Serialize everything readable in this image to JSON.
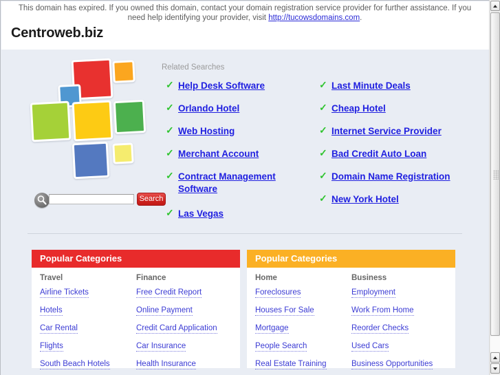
{
  "notice": {
    "text_before": "This domain has expired. If you owned this domain, contact your domain registration service provider for further assistance. If you need help identifying your provider, visit ",
    "link": "http://tucowsdomains.com",
    "text_after": "."
  },
  "site": {
    "title": "Centroweb.biz"
  },
  "logo": {
    "name": "colored-squares-mosaic",
    "colors": {
      "red": "#e8312f",
      "orange": "#fba61f",
      "blue_small": "#4f97d1",
      "green_light": "#a5d138",
      "yellow": "#fdcb14",
      "green": "#4cb04e",
      "blue": "#5479c0",
      "yellow_light": "#f5ec6e"
    }
  },
  "search": {
    "icon": "magnifier-icon",
    "value": "",
    "placeholder": "",
    "button_label": "Search"
  },
  "related": {
    "label": "Related Searches",
    "left_items": [
      "Help Desk Software",
      "Orlando Hotel",
      "Web Hosting",
      "Merchant Account",
      "Contract Management Software",
      "Las Vegas"
    ],
    "right_items": [
      "Last Minute Deals",
      "Cheap Hotel",
      "Internet Service Provider",
      "Bad Credit Auto Loan",
      "Domain Name Registration",
      "New York Hotel"
    ],
    "check_color": "#2fc42f",
    "link_color": "#2020e0"
  },
  "panels": [
    {
      "title": "Popular Categories",
      "header_color": "#e82b2b",
      "columns": [
        {
          "title": "Travel",
          "links": [
            "Airline Tickets",
            "Hotels",
            "Car Rental",
            "Flights",
            "South Beach Hotels"
          ]
        },
        {
          "title": "Finance",
          "links": [
            "Free Credit Report",
            "Online Payment",
            "Credit Card Application",
            "Car Insurance",
            "Health Insurance"
          ]
        }
      ]
    },
    {
      "title": "Popular Categories",
      "header_color": "#fbb024",
      "columns": [
        {
          "title": "Home",
          "links": [
            "Foreclosures",
            "Houses For Sale",
            "Mortgage",
            "People Search",
            "Real Estate Training"
          ]
        },
        {
          "title": "Business",
          "links": [
            "Employment",
            "Work From Home",
            "Reorder Checks",
            "Used Cars",
            "Business Opportunities"
          ]
        }
      ]
    }
  ],
  "scrollbar": {
    "up_arrow": "scroll-up-arrow-icon",
    "down_arrow": "scroll-down-arrow-icon"
  }
}
